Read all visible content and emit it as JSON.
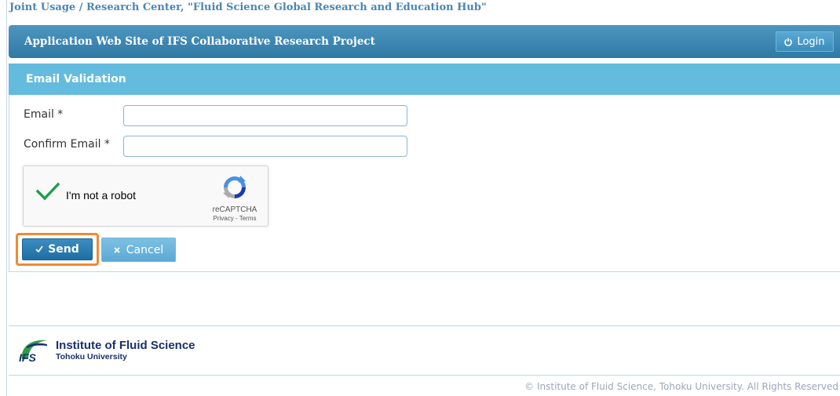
{
  "banner": {
    "text": "Joint Usage / Research Center, \"Fluid Science Global Research and Education Hub\""
  },
  "header": {
    "title": "Application Web Site of IFS Collaborative Research Project",
    "login_label": "Login"
  },
  "panel": {
    "title": "Email Validation"
  },
  "form": {
    "email_label": "Email *",
    "email_value": "",
    "confirm_label": "Confirm Email *",
    "confirm_value": ""
  },
  "recaptcha": {
    "label": "I'm not a robot",
    "checked": true,
    "brand": "reCAPTCHA",
    "links": "Privacy - Terms"
  },
  "actions": {
    "send_label": "Send",
    "cancel_label": "Cancel"
  },
  "footer": {
    "institute": "Institute of Fluid Science",
    "university": "Tohoku University",
    "copyright": "© Institute of Fluid Science, Tohoku University. All Rights Reserved"
  },
  "colors": {
    "header": "#2f79a6",
    "panel": "#63bbde",
    "highlight": "#f08a35",
    "brand": "#1b2f6b"
  }
}
